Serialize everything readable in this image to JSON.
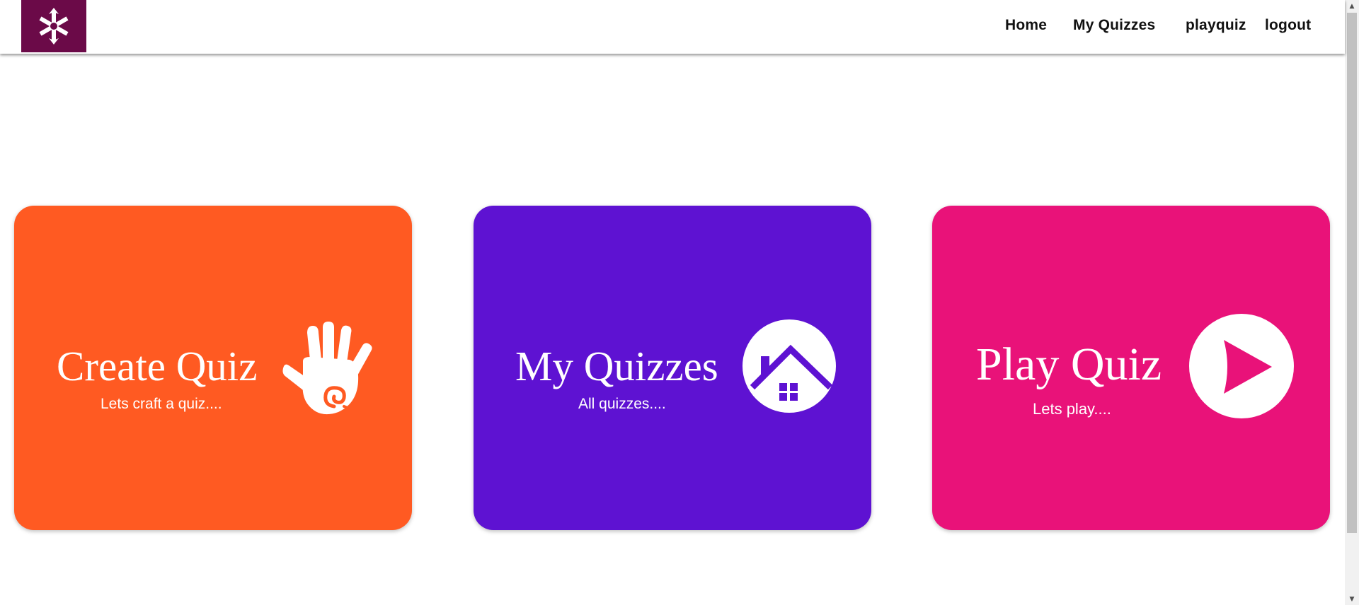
{
  "nav": {
    "links": [
      {
        "label": "Home"
      },
      {
        "label": "My Quizzes"
      },
      {
        "label": "playquiz"
      },
      {
        "label": "logout"
      }
    ],
    "logo_icon": "snowflake-logo-icon"
  },
  "cards": [
    {
      "title": "Create Quiz",
      "subtitle": "Lets craft a quiz....",
      "icon": "hand-icon",
      "color": "#ff5a22"
    },
    {
      "title": "My Quizzes",
      "subtitle": "All quizzes....",
      "icon": "house-icon",
      "color": "#5e12d2"
    },
    {
      "title": "Play Quiz",
      "subtitle": "Lets play....",
      "icon": "play-icon",
      "color": "#e91279"
    }
  ],
  "colors": {
    "logo_bg": "#6b0a48",
    "create_card": "#ff5a22",
    "my_quizzes_card": "#5e12d2",
    "play_card": "#e91279"
  }
}
